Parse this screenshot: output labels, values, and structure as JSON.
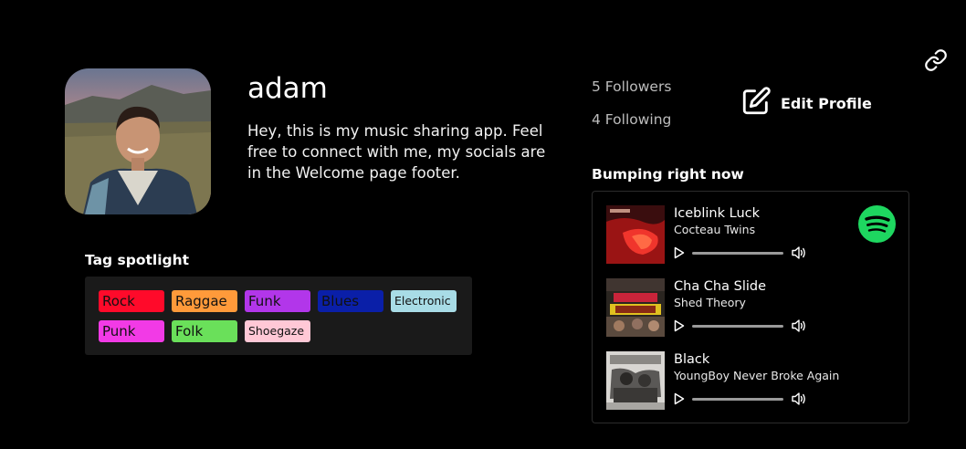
{
  "profile": {
    "username": "adam",
    "bio": "Hey, this is my music sharing app. Feel free to connect with me, my socials are in the Welcome page footer.",
    "followers": "5 Followers",
    "following": "4 Following",
    "edit_label": "Edit Profile"
  },
  "tags": {
    "title": "Tag spotlight",
    "items": [
      {
        "label": "Rock",
        "color": "#ff0a2a"
      },
      {
        "label": "Raggae",
        "color": "#ff9a3a"
      },
      {
        "label": "Funk",
        "color": "#b236ea"
      },
      {
        "label": "Blues",
        "color": "#0a1fa8"
      },
      {
        "label": "Electronic",
        "color": "#a8dce6"
      },
      {
        "label": "Punk",
        "color": "#f23ae6"
      },
      {
        "label": "Folk",
        "color": "#6ae05a"
      },
      {
        "label": "Shoegaze",
        "color": "#ffc8d6"
      }
    ]
  },
  "bumping": {
    "title": "Bumping right now",
    "tracks": [
      {
        "title": "Iceblink Luck",
        "artist": "Cocteau Twins"
      },
      {
        "title": "Cha Cha Slide",
        "artist": "Shed Theory"
      },
      {
        "title": "Black",
        "artist": "YoungBoy Never Broke Again"
      }
    ],
    "service_icon": "spotify-icon",
    "accent": "#1ed760"
  },
  "icons": {
    "share": "link-icon",
    "edit": "edit-icon",
    "play": "play-icon",
    "volume": "volume-icon"
  }
}
